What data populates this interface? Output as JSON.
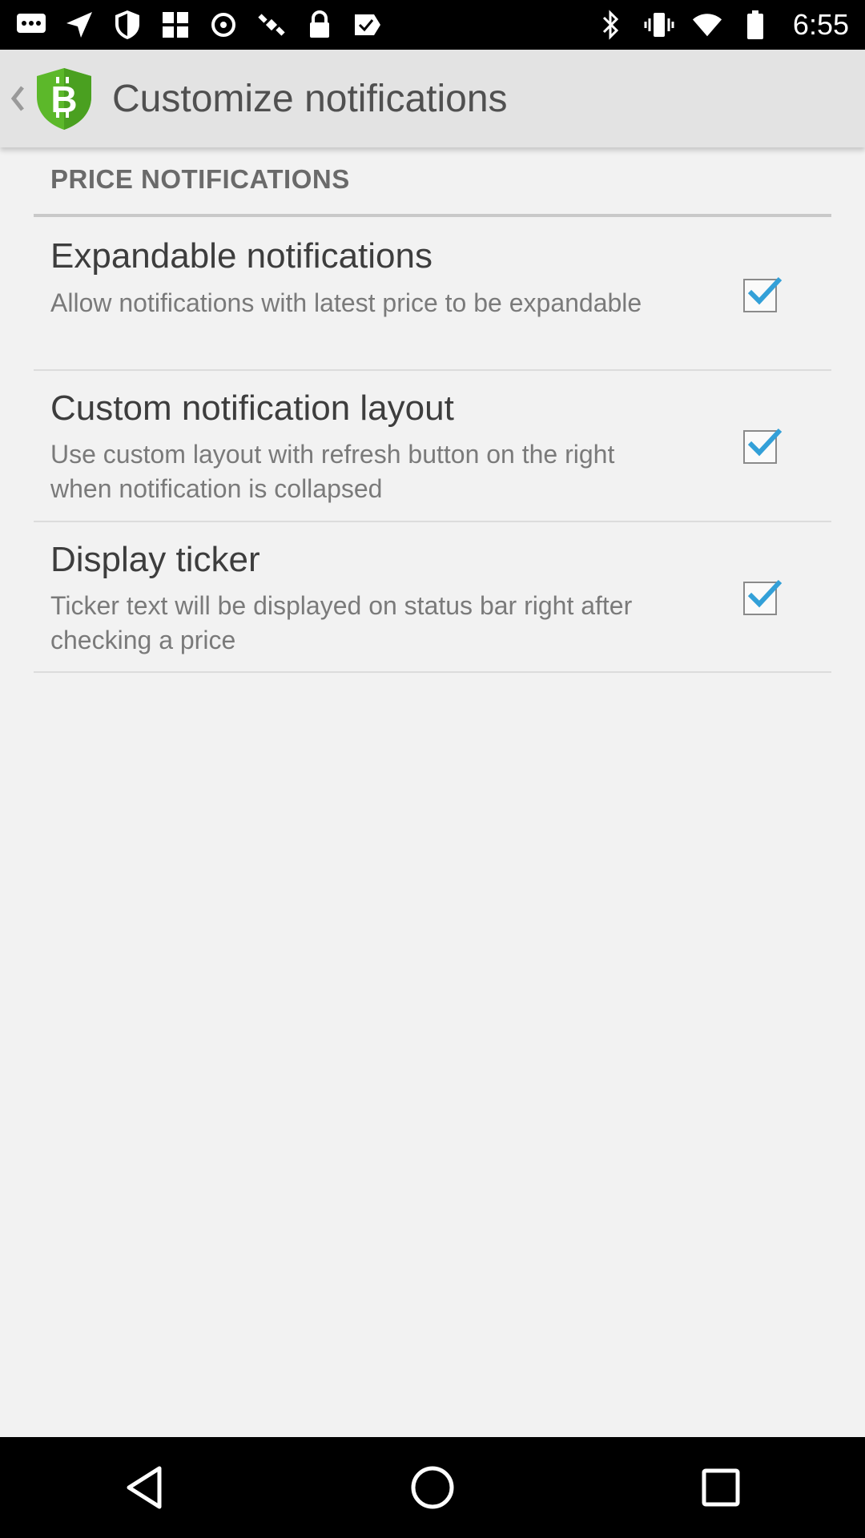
{
  "status_bar": {
    "time": "6:55",
    "left_icons": [
      "messages-icon",
      "navigation-icon",
      "shield-icon",
      "grid-icon",
      "sync-icon",
      "satellite-icon",
      "lock-icon",
      "check-icon"
    ],
    "right_icons": [
      "bluetooth-icon",
      "vibrate-icon",
      "wifi-icon",
      "battery-icon"
    ]
  },
  "action_bar": {
    "title": "Customize notifications",
    "app_icon": "bitcoin-shield-icon",
    "accent_color": "#5cb82a"
  },
  "section": {
    "header": "PRICE NOTIFICATIONS"
  },
  "preferences": [
    {
      "title": "Expandable notifications",
      "summary": "Allow notifications with latest price to be expandable",
      "checked": true
    },
    {
      "title": "Custom notification layout",
      "summary": "Use custom layout with refresh button on the right when notification is collapsed",
      "checked": true
    },
    {
      "title": "Display ticker",
      "summary": "Ticker text will be displayed on status bar right after checking a price",
      "checked": true
    }
  ],
  "nav_bar": {
    "buttons": [
      "back-icon",
      "home-icon",
      "recents-icon"
    ]
  },
  "colors": {
    "check": "#33a0d8"
  }
}
